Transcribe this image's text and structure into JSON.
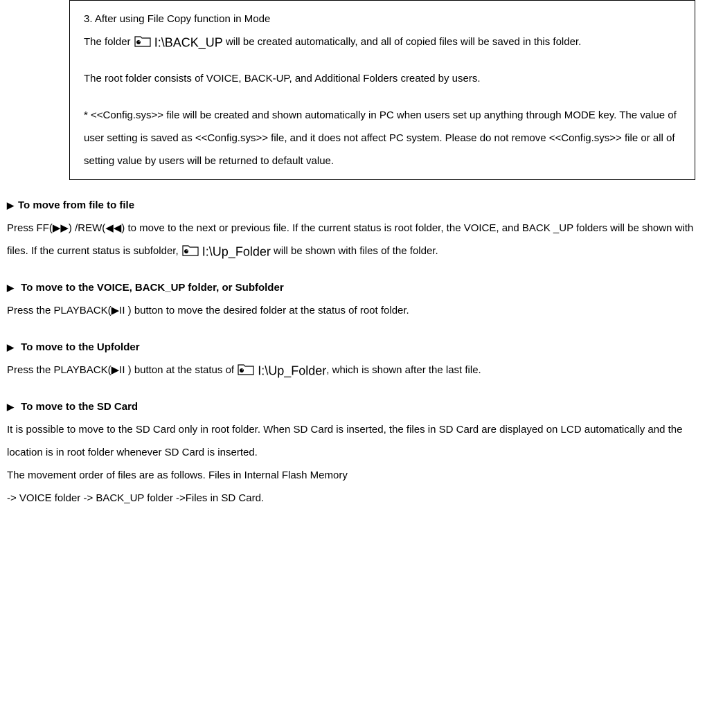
{
  "box": {
    "title": "3. After using File Copy function in Mode",
    "before_folder": "The folder ",
    "after_folder": " will be created automatically, and all of copied files will be saved in this folder.",
    "root_folder": "The root folder consists of VOICE, BACK-UP, and Additional Folders created by users.",
    "config": "* <<Config.sys>> file will be created and shown automatically in PC when users set up anything through MODE key. The value of user setting is saved as <<Config.sys>> file, and it does not affect PC system. Please do not remove <<Config.sys>> file or all of setting value by users will be returned to default value."
  },
  "folders": {
    "backup": "I:\\BACK_UP",
    "upfolder": "I:\\Up_Folder"
  },
  "sections": {
    "s1": {
      "title": "To move from file to file",
      "body1": "Press FF(▶▶) /REW(◀◀) to move to the next or previous file.  If the current status is root folder, the VOICE, and BACK _UP folders will be shown with files.  If the current status is subfolder, ",
      "body2": " will be shown with files of the folder."
    },
    "s2": {
      "title": " To move to the VOICE, BACK_UP folder, or Subfolder",
      "body": "Press the PLAYBACK(▶II ) button to move the desired folder at the status of root folder."
    },
    "s3": {
      "title": " To move to the Upfolder",
      "body1": "Press the PLAYBACK(▶II ) button at the status of ",
      "body2": ", which is shown after the last file."
    },
    "s4": {
      "title": " To move to the SD Card",
      "body1": "It is possible to move to the SD Card only in root folder.  When SD Card is inserted, the files in SD Card are displayed on LCD automatically and the location is in root folder whenever SD Card is inserted.",
      "body2": "The movement order of files are as follows.  Files in Internal Flash Memory",
      "body3": " -> VOICE folder -> BACK_UP folder ->Files in SD Card."
    }
  }
}
